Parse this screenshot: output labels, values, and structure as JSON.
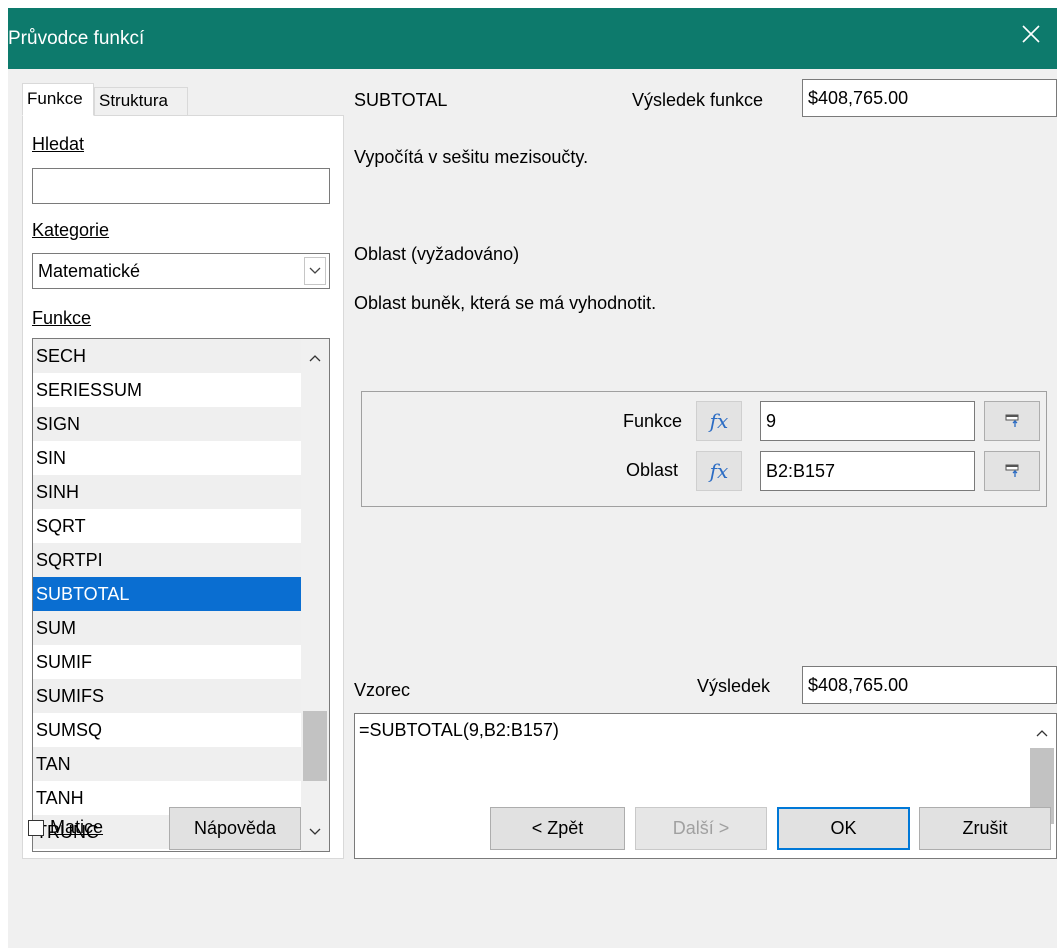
{
  "window": {
    "title": "Průvodce funkcí"
  },
  "tabs": [
    {
      "label": "Funkce"
    },
    {
      "label": "Struktura"
    }
  ],
  "search": {
    "label": "Hledat",
    "value": ""
  },
  "category": {
    "label": "Kategorie",
    "value": "Matematické"
  },
  "functions": {
    "label": "Funkce",
    "items": [
      "SECH",
      "SERIESSUM",
      "SIGN",
      "SIN",
      "SINH",
      "SQRT",
      "SQRTPI",
      "SUBTOTAL",
      "SUM",
      "SUMIF",
      "SUMIFS",
      "SUMSQ",
      "TAN",
      "TANH",
      "TRUNC"
    ],
    "selected": "SUBTOTAL"
  },
  "function_info": {
    "name": "SUBTOTAL",
    "result_label": "Výsledek funkce",
    "result_value": "$408,765.00",
    "description": "Vypočítá v sešitu mezisoučty.",
    "arg_title": "Oblast (vyžadováno)",
    "arg_description": "Oblast buněk, která se má vyhodnotit."
  },
  "arguments": [
    {
      "label": "Funkce",
      "value": "9"
    },
    {
      "label": "Oblast",
      "value": "B2:B157"
    }
  ],
  "formula": {
    "label": "Vzorec",
    "text": "=SUBTOTAL(9,B2:B157)",
    "result_label": "Výsledek",
    "result_value": "$408,765.00"
  },
  "array_checkbox": {
    "label": "Matice",
    "checked": false
  },
  "buttons": {
    "help": "Nápověda",
    "back": "< Zpět",
    "next": "Další >",
    "ok": "OK",
    "cancel": "Zrušit"
  },
  "icons": {
    "fx": "fx-icon",
    "shrink": "shrink-icon",
    "close": "close-icon"
  },
  "colors": {
    "titlebar": "#0d7a6c",
    "selection": "#0a6ed1",
    "fx": "#2b6cc4"
  }
}
